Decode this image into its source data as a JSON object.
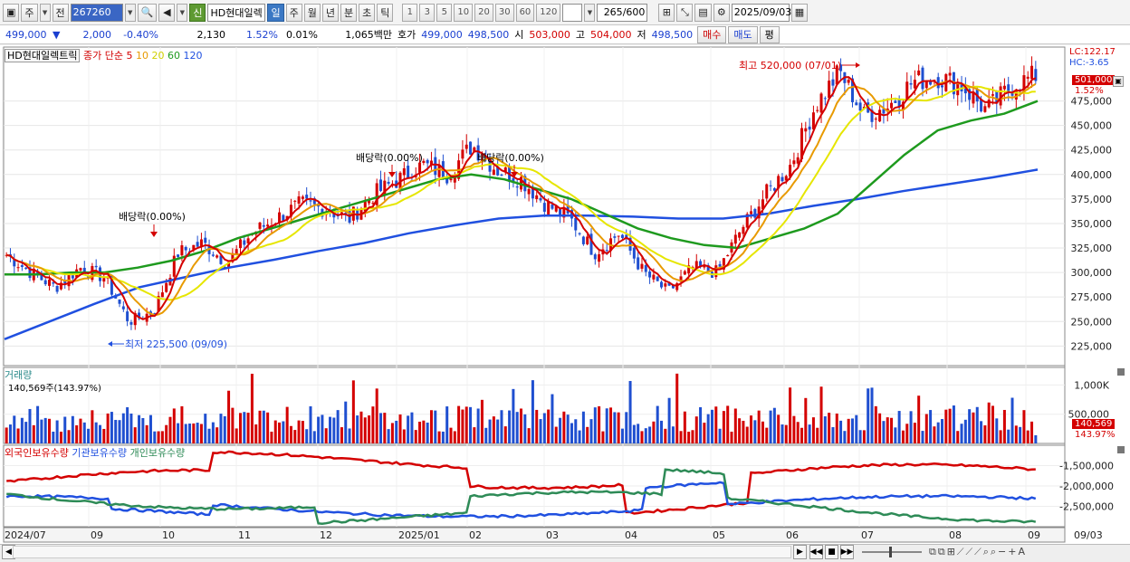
{
  "toolbar": {
    "market": "주",
    "prefix": "전",
    "code": "267260",
    "badge": "신",
    "name": "HD현대일렉",
    "periods": [
      "일",
      "주",
      "월",
      "년",
      "분",
      "초",
      "틱"
    ],
    "active_period": "일",
    "intervals": [
      "1",
      "3",
      "5",
      "10",
      "20",
      "30",
      "60",
      "120"
    ],
    "count": "265",
    "count_max": "/600",
    "date": "2025/09/03"
  },
  "quote": {
    "price": "499,000",
    "change": "2,000",
    "change_pct": "-0.40%",
    "volume": "2,130",
    "vol_pct": "1.52%",
    "turnover_pct": "0.01%",
    "amount": "1,065백만",
    "bid_label": "호가",
    "bid": "499,000",
    "ask": "498,500",
    "open_label": "시",
    "open": "503,000",
    "high_label": "고",
    "high": "504,000",
    "low_label": "저",
    "low": "498,500",
    "buy": "매수",
    "sell": "매도",
    "eval": "평"
  },
  "legend": {
    "stock": "HD현대일렉트릭",
    "ma_label": "종가 단순",
    "ma_periods": [
      "5",
      "10",
      "20",
      "60",
      "120"
    ],
    "ma_colors": [
      "#d40000",
      "#e89a00",
      "#e6e600",
      "#1e9a1e",
      "#2050e0"
    ],
    "volume_label": "거래량",
    "volume_value": "140,569주(143.97%)",
    "holdings_labels": [
      "외국인보유수량",
      "기관보유수량",
      "개인보유수량"
    ],
    "holdings_colors": [
      "#d40000",
      "#2050e0",
      "#2e8b57"
    ]
  },
  "annotations": {
    "high": "최고 520,000 (07/01)",
    "low": "최저 225,500 (09/09)",
    "dividends": [
      "배당락(0.00%)",
      "배당락(0.00%)",
      "배당락(0.00%)"
    ],
    "lc": "LC:122.17",
    "hc": "HC:-3.65",
    "last_price": "501,000",
    "last_pct": "1.52%",
    "last_volume": "140,569",
    "last_vol_pct": "143.97%"
  },
  "chart_data": [
    {
      "type": "candlestick",
      "title": "HD현대일렉트릭",
      "y_ticks": [
        "475,000",
        "450,000",
        "425,000",
        "400,000",
        "375,000",
        "350,000",
        "325,000",
        "300,000",
        "275,000",
        "250,000",
        "225,000"
      ],
      "ylim": [
        205000,
        530000
      ],
      "x_ticks": [
        "2024/07",
        "09",
        "10",
        "11",
        "12",
        "2025/01",
        "02",
        "03",
        "04",
        "05",
        "06",
        "07",
        "08",
        "09",
        "09/03"
      ],
      "close_approx": [
        318000,
        300000,
        285000,
        305000,
        295000,
        250000,
        260000,
        320000,
        330000,
        310000,
        340000,
        355000,
        370000,
        365000,
        355000,
        380000,
        395000,
        410000,
        400000,
        430000,
        405000,
        395000,
        370000,
        355000,
        320000,
        340000,
        300000,
        280000,
        305000,
        300000,
        345000,
        380000,
        410000,
        470000,
        505000,
        460000,
        470000,
        495000,
        500000,
        490000,
        465000,
        490000,
        501000
      ],
      "series": [
        {
          "name": "5",
          "color": "#d40000"
        },
        {
          "name": "10",
          "color": "#e89a00"
        },
        {
          "name": "20",
          "color": "#e6e600"
        },
        {
          "name": "60",
          "color": "#1e9a1e"
        },
        {
          "name": "120",
          "color": "#2050e0"
        }
      ],
      "ma60_approx": [
        298000,
        298000,
        300000,
        300000,
        305000,
        312000,
        322000,
        335000,
        345000,
        355000,
        365000,
        375000,
        385000,
        395000,
        400000,
        395000,
        385000,
        375000,
        360000,
        345000,
        335000,
        328000,
        325000,
        335000,
        345000,
        360000,
        390000,
        420000,
        445000,
        455000,
        462000,
        475000
      ],
      "ma120_approx": [
        232000,
        250000,
        268000,
        285000,
        295000,
        305000,
        313000,
        322000,
        330000,
        340000,
        348000,
        355000,
        358000,
        358000,
        357000,
        355000,
        355000,
        360000,
        368000,
        375000,
        383000,
        390000,
        397000,
        405000
      ]
    },
    {
      "type": "bar",
      "title": "거래량",
      "y_ticks": [
        "1,000K",
        "500,000"
      ],
      "last_value": 140569
    },
    {
      "type": "line",
      "title": "보유수량",
      "y_ticks": [
        "-1,500,000",
        "-2,000,000",
        "-2,500,000"
      ],
      "series": [
        {
          "name": "외국인보유수량",
          "color": "#d40000"
        },
        {
          "name": "기관보유수량",
          "color": "#2050e0"
        },
        {
          "name": "개인보유수량",
          "color": "#2e8b57"
        }
      ]
    }
  ]
}
